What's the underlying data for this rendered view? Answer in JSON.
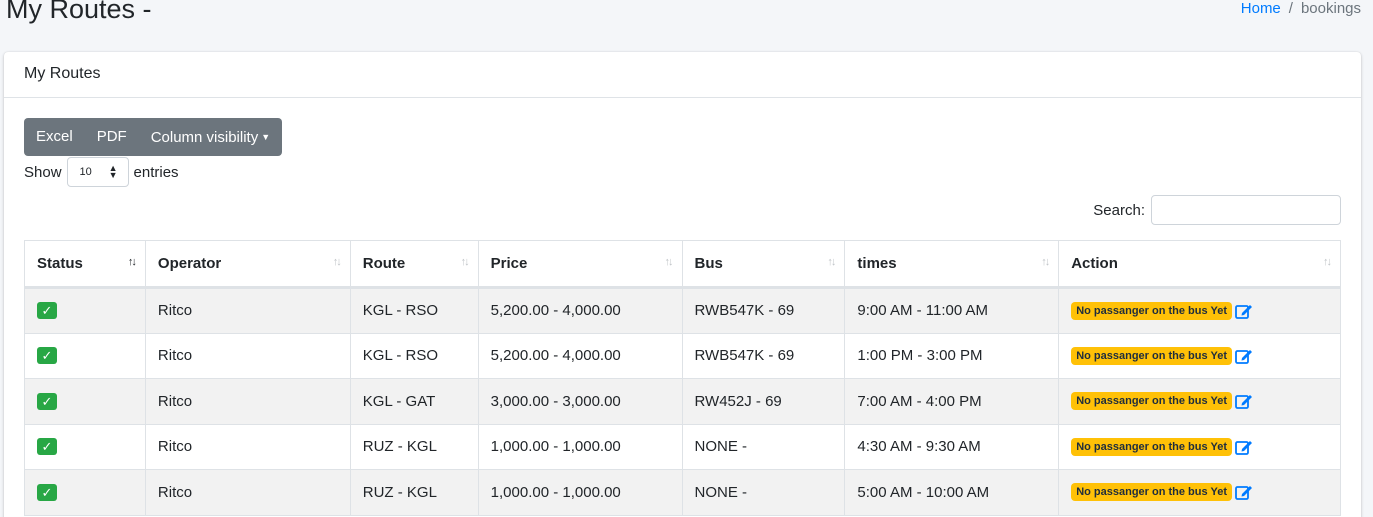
{
  "header": {
    "title": "My Routes -",
    "breadcrumb": {
      "home": "Home",
      "separator": "/",
      "current": "bookings"
    }
  },
  "card": {
    "title": "My Routes"
  },
  "toolbar": {
    "excel_label": "Excel",
    "pdf_label": "PDF",
    "column_visibility_label": "Column visibility"
  },
  "length": {
    "show_label": "Show",
    "value": "10",
    "entries_label": "entries"
  },
  "search": {
    "label": "Search:",
    "value": ""
  },
  "table": {
    "columns": [
      "Status",
      "Operator",
      "Route",
      "Price",
      "Bus",
      "times",
      "Action"
    ],
    "rows": [
      {
        "operator": "Ritco",
        "route": "KGL - RSO",
        "price": "5,200.00 - 4,000.00",
        "bus": "RWB547K - 69",
        "times": "9:00 AM - 11:00 AM",
        "action_badge": "No passanger on the bus Yet"
      },
      {
        "operator": "Ritco",
        "route": "KGL - RSO",
        "price": "5,200.00 - 4,000.00",
        "bus": "RWB547K - 69",
        "times": "1:00 PM - 3:00 PM",
        "action_badge": "No passanger on the bus Yet"
      },
      {
        "operator": "Ritco",
        "route": "KGL - GAT",
        "price": "3,000.00 - 3,000.00",
        "bus": "RW452J - 69",
        "times": "7:00 AM - 4:00 PM",
        "action_badge": "No passanger on the bus Yet"
      },
      {
        "operator": "Ritco",
        "route": "RUZ - KGL",
        "price": "1,000.00 - 1,000.00",
        "bus": "NONE -",
        "times": "4:30 AM - 9:30 AM",
        "action_badge": "No passanger on the bus Yet"
      },
      {
        "operator": "Ritco",
        "route": "RUZ - KGL",
        "price": "1,000.00 - 1,000.00",
        "bus": "NONE -",
        "times": "5:00 AM - 10:00 AM",
        "action_badge": "No passanger on the bus Yet"
      }
    ]
  },
  "colors": {
    "accent": "#007bff",
    "status_ok": "#28a745",
    "badge_warning": "#ffc107",
    "button_secondary": "#6c757d"
  },
  "icons": {
    "status": "check-square-icon",
    "edit": "edit-icon",
    "sort": "sort-arrows-icon"
  }
}
